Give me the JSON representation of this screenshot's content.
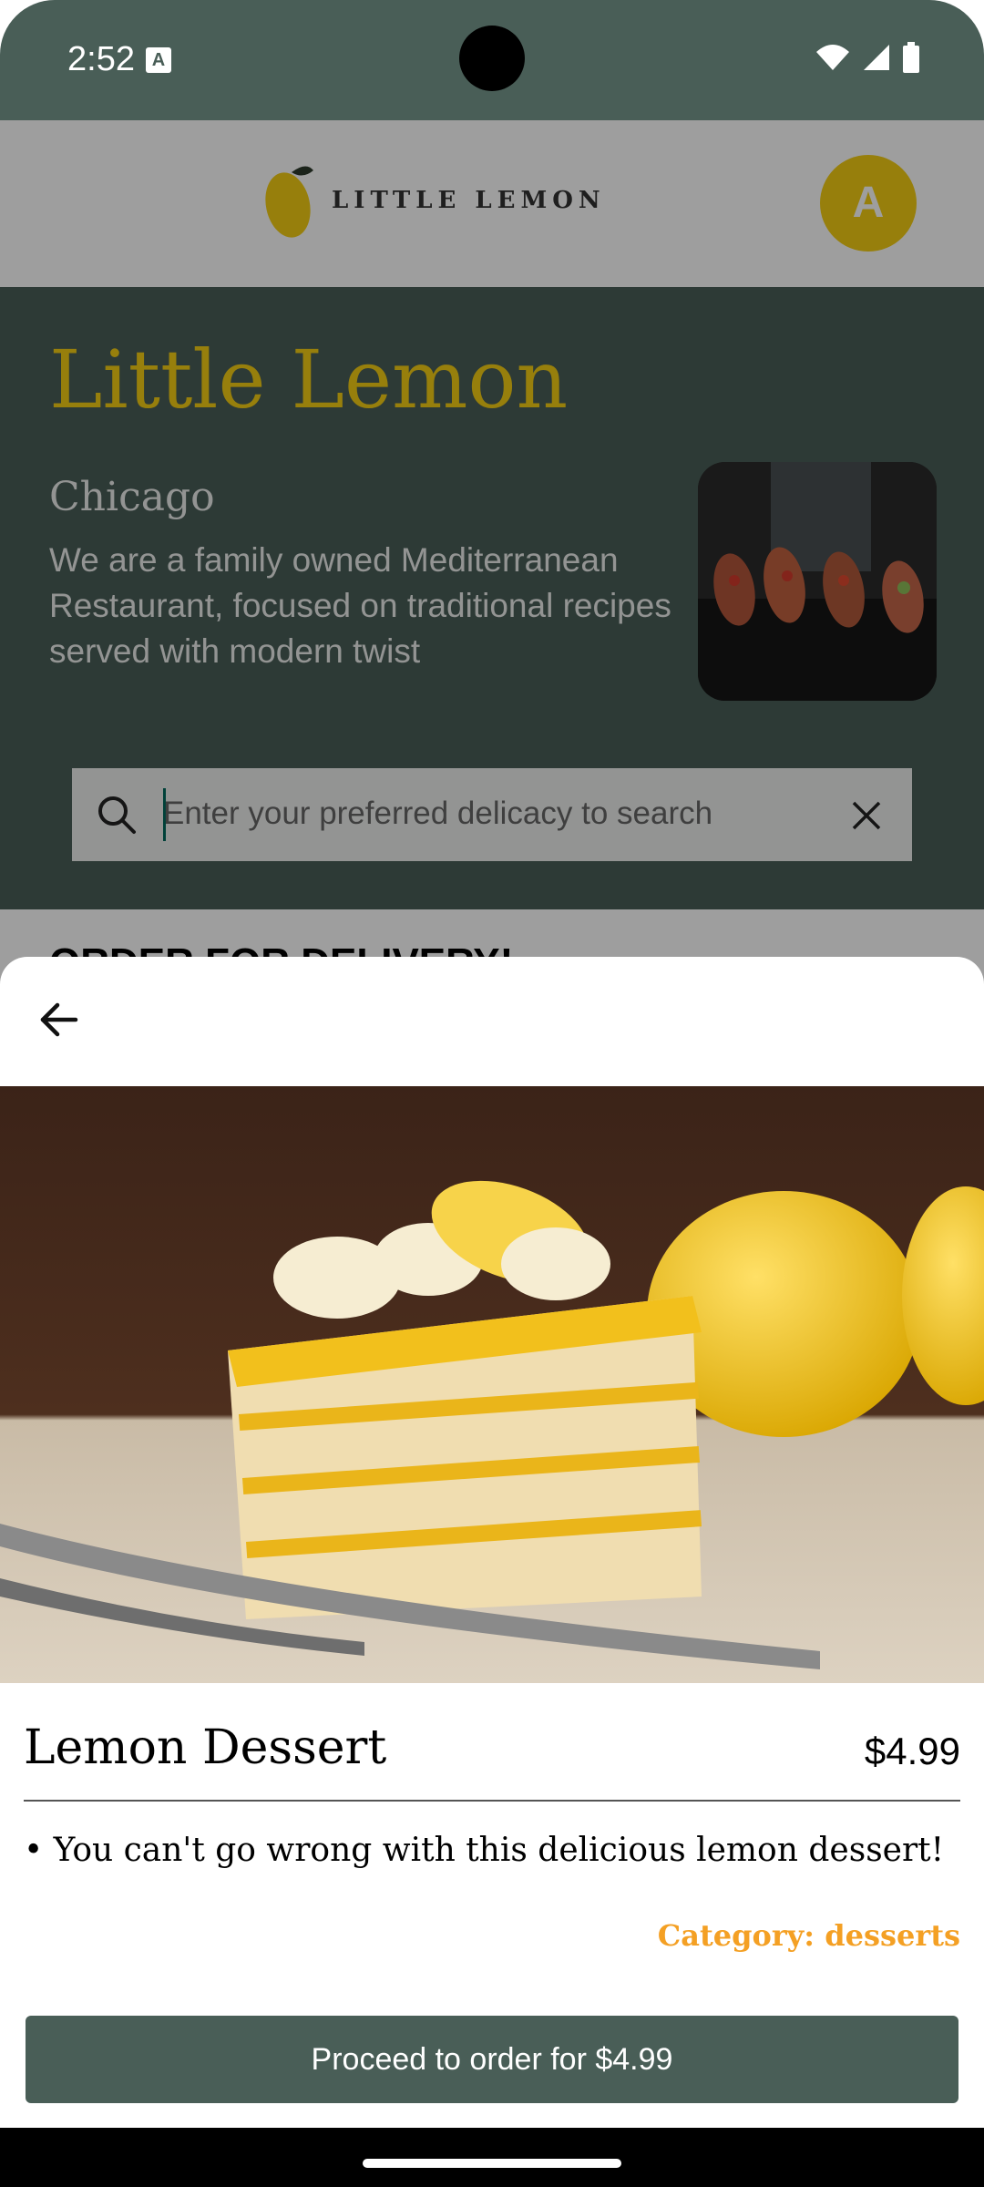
{
  "status_bar": {
    "time": "2:52",
    "a_icon_label": "A"
  },
  "header": {
    "logo_text": "LITTLE LEMON",
    "avatar_letter": "A"
  },
  "hero": {
    "title": "Little Lemon",
    "city": "Chicago",
    "description": "We are a family owned Mediterranean Restaurant, focused on traditional recipes served with modern twist",
    "image_icon": "bruschetta-photo"
  },
  "search": {
    "placeholder": "Enter your preferred delicacy to search"
  },
  "delivery": {
    "heading": "ORDER FOR DELIVERY!"
  },
  "sheet": {
    "dish_name": "Lemon Dessert",
    "price": "$4.99",
    "description": "• You can't go wrong with this delicious lemon dessert!",
    "category": "Category: desserts",
    "order_button_label": "Proceed to order for $4.99",
    "image_icon": "lemon-cake-photo"
  },
  "colors": {
    "primary_green": "#495E57",
    "primary_yellow": "#F4CE14",
    "category_orange": "#F4A024"
  }
}
